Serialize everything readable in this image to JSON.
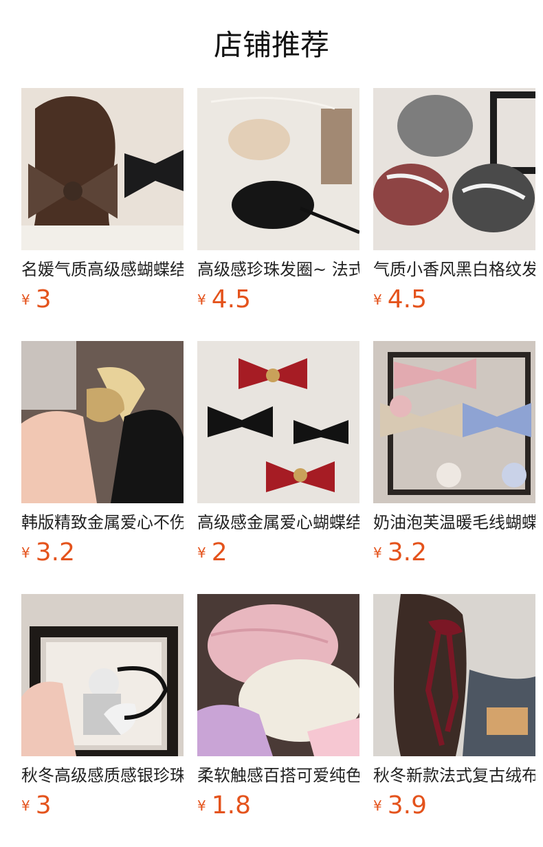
{
  "page": {
    "title": "店铺推荐"
  },
  "products": [
    {
      "name": "名媛气质高级感蝴蝶结发圈",
      "currency": "¥",
      "price": "3"
    },
    {
      "name": "高级感珍珠发圈~ 法式",
      "currency": "¥",
      "price": "4.5"
    },
    {
      "name": "气质小香风黑白格纹发圈",
      "currency": "¥",
      "price": "4.5"
    },
    {
      "name": "韩版精致金属爱心不伤发",
      "currency": "¥",
      "price": "3.2"
    },
    {
      "name": "高级感金属爱心蝴蝶结",
      "currency": "¥",
      "price": "2"
    },
    {
      "name": "奶油泡芙温暖毛线蝴蝶结",
      "currency": "¥",
      "price": "3.2"
    },
    {
      "name": "秋冬高级感质感银珍珠",
      "currency": "¥",
      "price": "3"
    },
    {
      "name": "柔软触感百搭可爱纯色",
      "currency": "¥",
      "price": "1.8"
    },
    {
      "name": "秋冬新款法式复古绒布",
      "currency": "¥",
      "price": "3.9"
    }
  ],
  "theme": {
    "price_color": "#e4531c"
  }
}
